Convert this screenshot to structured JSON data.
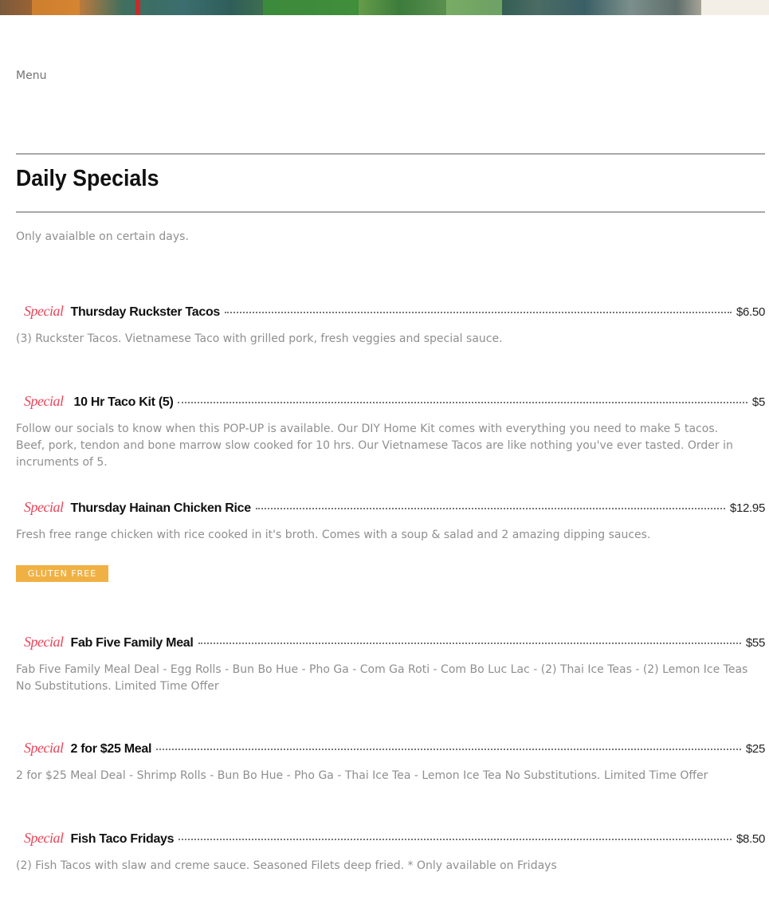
{
  "nav": {
    "menu_label": "Menu"
  },
  "section": {
    "title": "Daily Specials",
    "description": "Only avaialble on certain days."
  },
  "items": [
    {
      "badge": "Special",
      "name": "Thursday Ruckster Tacos",
      "price": "$6.50",
      "description": "(3) Ruckster Tacos. Vietnamese Taco with grilled pork, fresh veggies and special sauce."
    },
    {
      "badge": "Special",
      "name": "10 Hr Taco Kit (5)",
      "price": "$5",
      "description": "Follow our socials to know when this POP-UP is available. Our DIY Home Kit comes with everything you need to make 5 tacos. Beef, pork, tendon and bone marrow slow cooked for 10 hrs. Our Vietnamese Tacos are like nothing you've ever tasted. Order in incruments of 5."
    },
    {
      "badge": "Special",
      "name": "Thursday Hainan Chicken Rice",
      "price": "$12.95",
      "description": "Fresh free range chicken with rice cooked in it's broth. Comes with a soup & salad and 2 amazing dipping sauces.",
      "tag": "GLUTEN FREE"
    },
    {
      "badge": "Special",
      "name": "Fab Five Family Meal",
      "price": "$55",
      "description": "Fab Five Family Meal Deal - Egg Rolls - Bun Bo Hue - Pho Ga - Com Ga Roti - Com Bo Luc Lac - (2) Thai Ice Teas - (2) Lemon Ice Teas No Substitutions. Limited Time Offer"
    },
    {
      "badge": "Special",
      "name": "2 for $25 Meal",
      "price": "$25",
      "description": "2 for $25 Meal Deal - Shrimp Rolls - Bun Bo Hue - Pho Ga - Thai Ice Tea - Lemon Ice Tea No Substitutions. Limited Time Offer"
    },
    {
      "badge": "Special",
      "name": "Fish Taco Fridays",
      "price": "$8.50",
      "description": "(2) Fish Tacos with slaw and creme sauce. Seasoned Filets deep fried. * Only available on Fridays"
    }
  ],
  "colors": {
    "badge": "#e8455a",
    "tag_bg": "#f0b144",
    "desc_text": "#8f8f8f"
  }
}
